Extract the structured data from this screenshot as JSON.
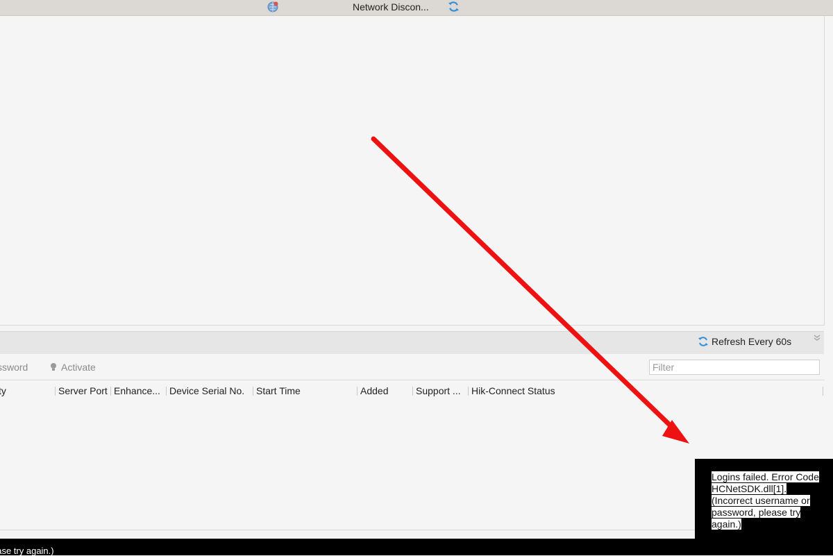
{
  "top_bar": {
    "network_status": "Network Discon...",
    "icons": [
      "network-globe-icon",
      "refresh-icon"
    ]
  },
  "device_panel": {
    "refresh_label": "Refresh Every 60s",
    "toolbar": {
      "password_label": "ssword",
      "activate_label": "Activate",
      "filter_placeholder": "Filter"
    },
    "columns": [
      "ty",
      "Server Port",
      "Enhance...",
      "Device Serial No.",
      "Start Time",
      "Added",
      "Support ...",
      "Hik-Connect Status"
    ]
  },
  "status_bar": {
    "text": "ease try again.)"
  },
  "error_toast": {
    "message": "Logins failed. Error Code HCNetSDK.dll[1]. (Incorrect username or password, please try again.)"
  },
  "annotation": {
    "arrow_color": "#ee1111"
  },
  "colors": {
    "accent_blue": "#2f8fd8",
    "top_bar_bg": "#dcd8d3",
    "panel_bg": "#f5f5f5"
  }
}
